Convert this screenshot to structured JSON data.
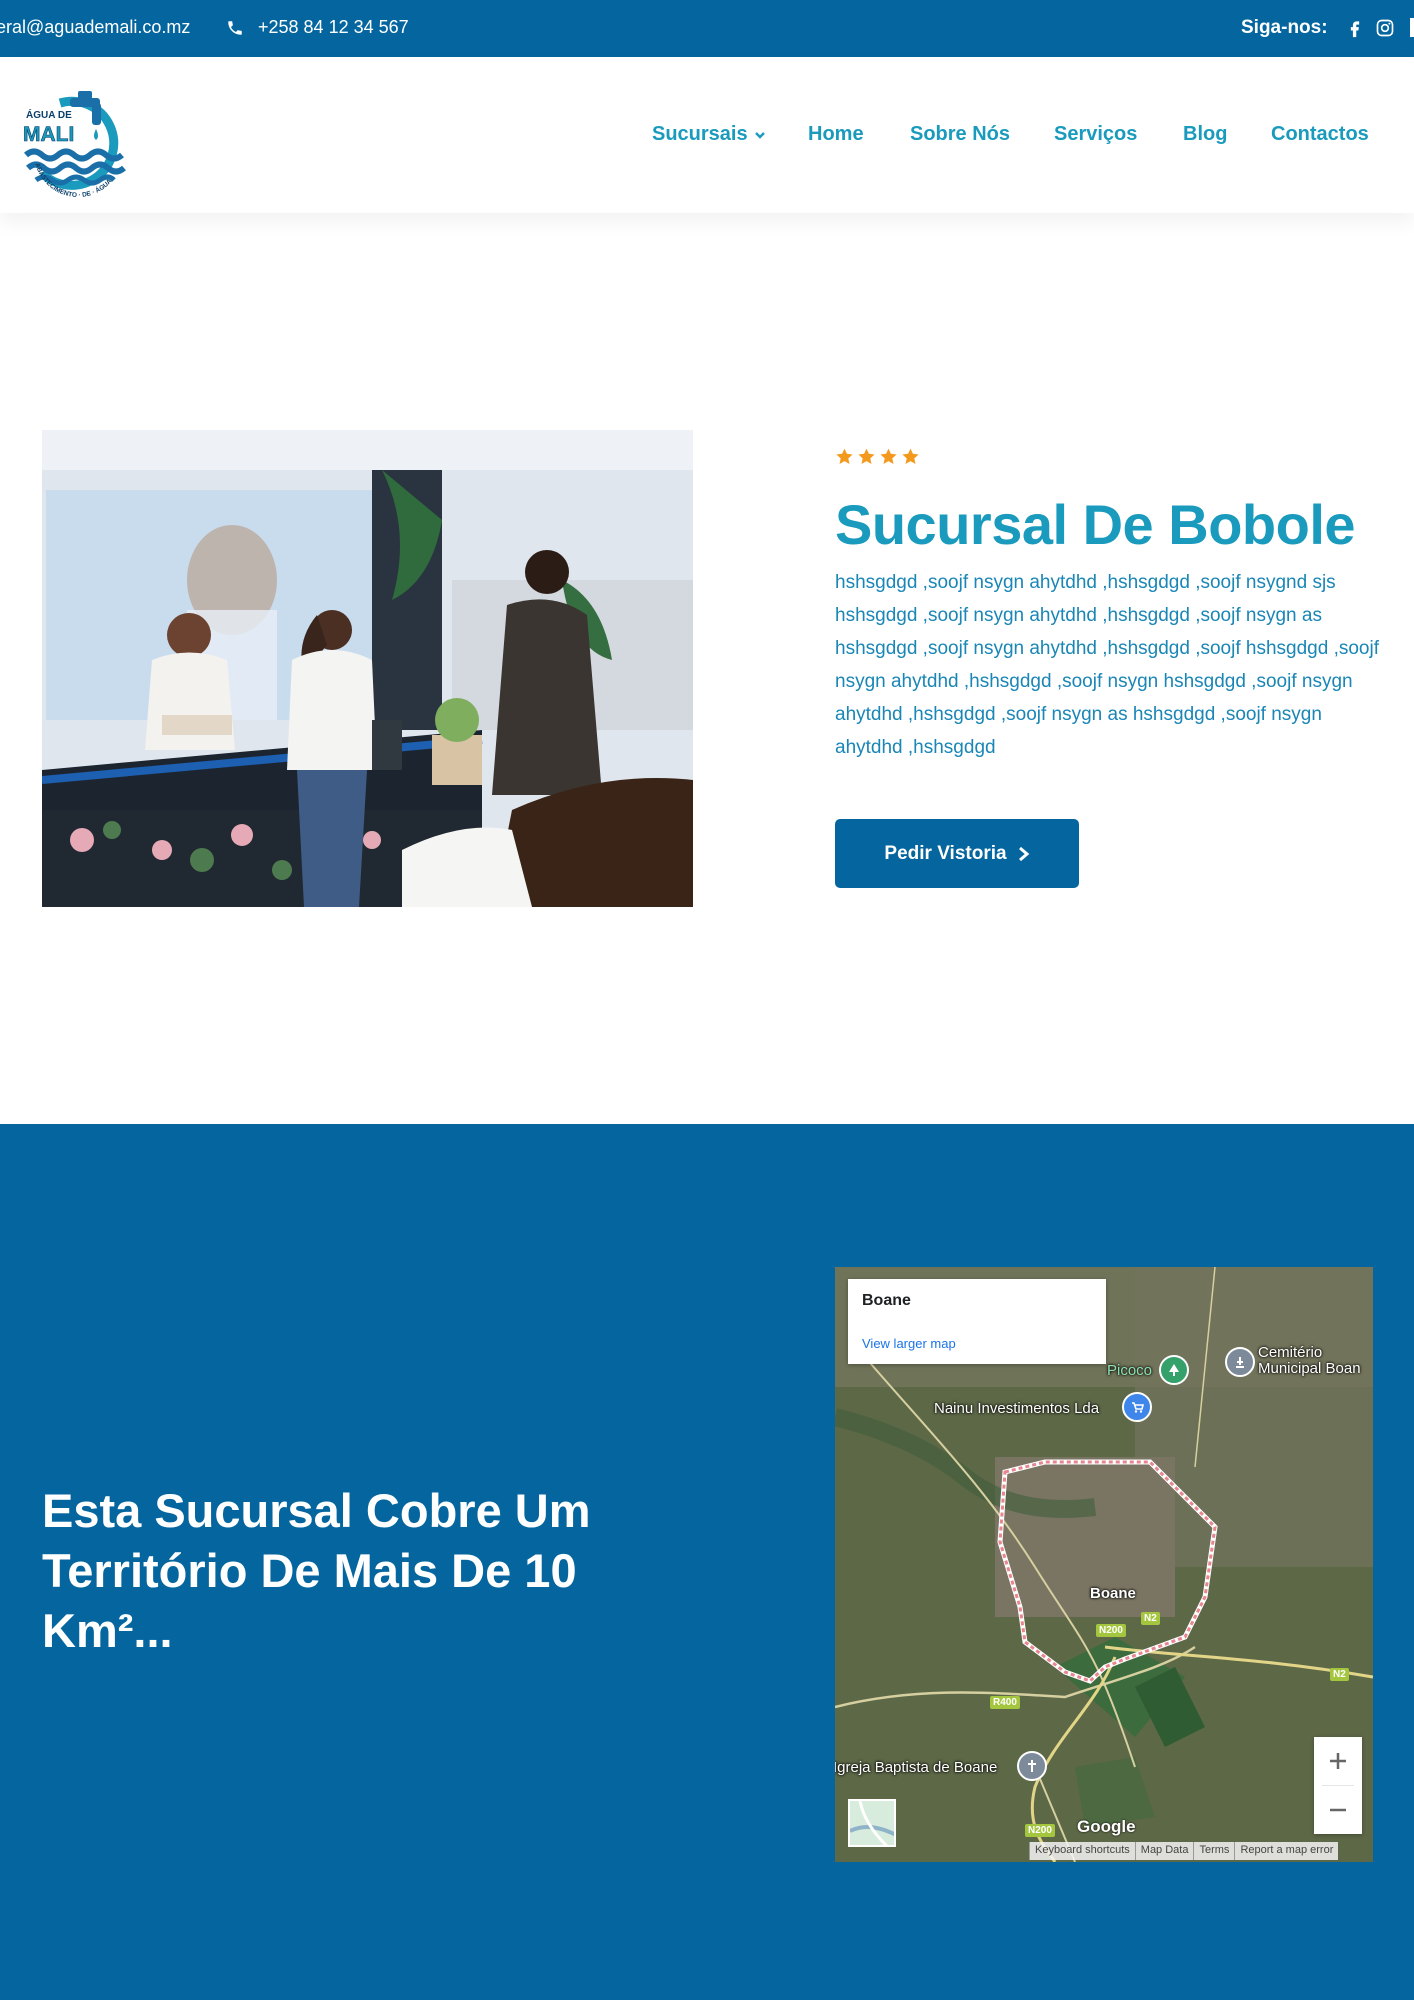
{
  "topbar": {
    "email": "geral@aguademali.co.mz",
    "phone": "+258 84 12 34 567",
    "follow_label": "Siga-nos:",
    "social_icons": [
      "facebook-icon",
      "instagram-icon"
    ]
  },
  "logo": {
    "top_text": "ÁGUA DE",
    "main_text": "MALI",
    "ring_text": "ABASTECIMENTO DE ÁGUA"
  },
  "nav": {
    "items": [
      "Sucursais",
      "Home",
      "Sobre Nós",
      "Serviços",
      "Blog",
      "Contactos"
    ]
  },
  "branch": {
    "rating": 4,
    "title": "Sucursal De Bobole",
    "description": "hshsgdgd ,soojf nsygn ahytdhd ,hshsgdgd ,soojf nsygnd sjs hshsgdgd ,soojf nsygn ahytdhd ,hshsgdgd ,soojf nsygn as hshsgdgd ,soojf nsygn ahytdhd ,hshsgdgd ,soojf hshsgdgd ,soojf nsygn ahytdhd ,hshsgdgd ,soojf nsygn hshsgdgd ,soojf nsygn ahytdhd ,hshsgdgd ,soojf nsygn as hshsgdgd ,soojf nsygn ahytdhd ,hshsgdgd",
    "cta_label": "Pedir Vistoria"
  },
  "coverage": {
    "text": "Esta Sucursal Cobre Um Território De Mais De 10 Km²..."
  },
  "map": {
    "place": "Boane",
    "view_larger": "View larger map",
    "labels": {
      "picoco": "Picoco",
      "cemiterio_1": "Cemitério",
      "cemiterio_2": "Municipal Boan",
      "nainu": "Nainu Investimentos Lda",
      "boane": "Boane",
      "igreja": "Igreja Baptista de Boane"
    },
    "roads": [
      "N200",
      "N2",
      "N2",
      "R400",
      "N200"
    ],
    "google": "Google",
    "attribution": [
      "Keyboard shortcuts",
      "Map Data",
      "Terms",
      "Report a map error"
    ]
  },
  "colors": {
    "primary": "#05669f",
    "accent": "#1a9bbd",
    "star": "#f39a1e"
  }
}
